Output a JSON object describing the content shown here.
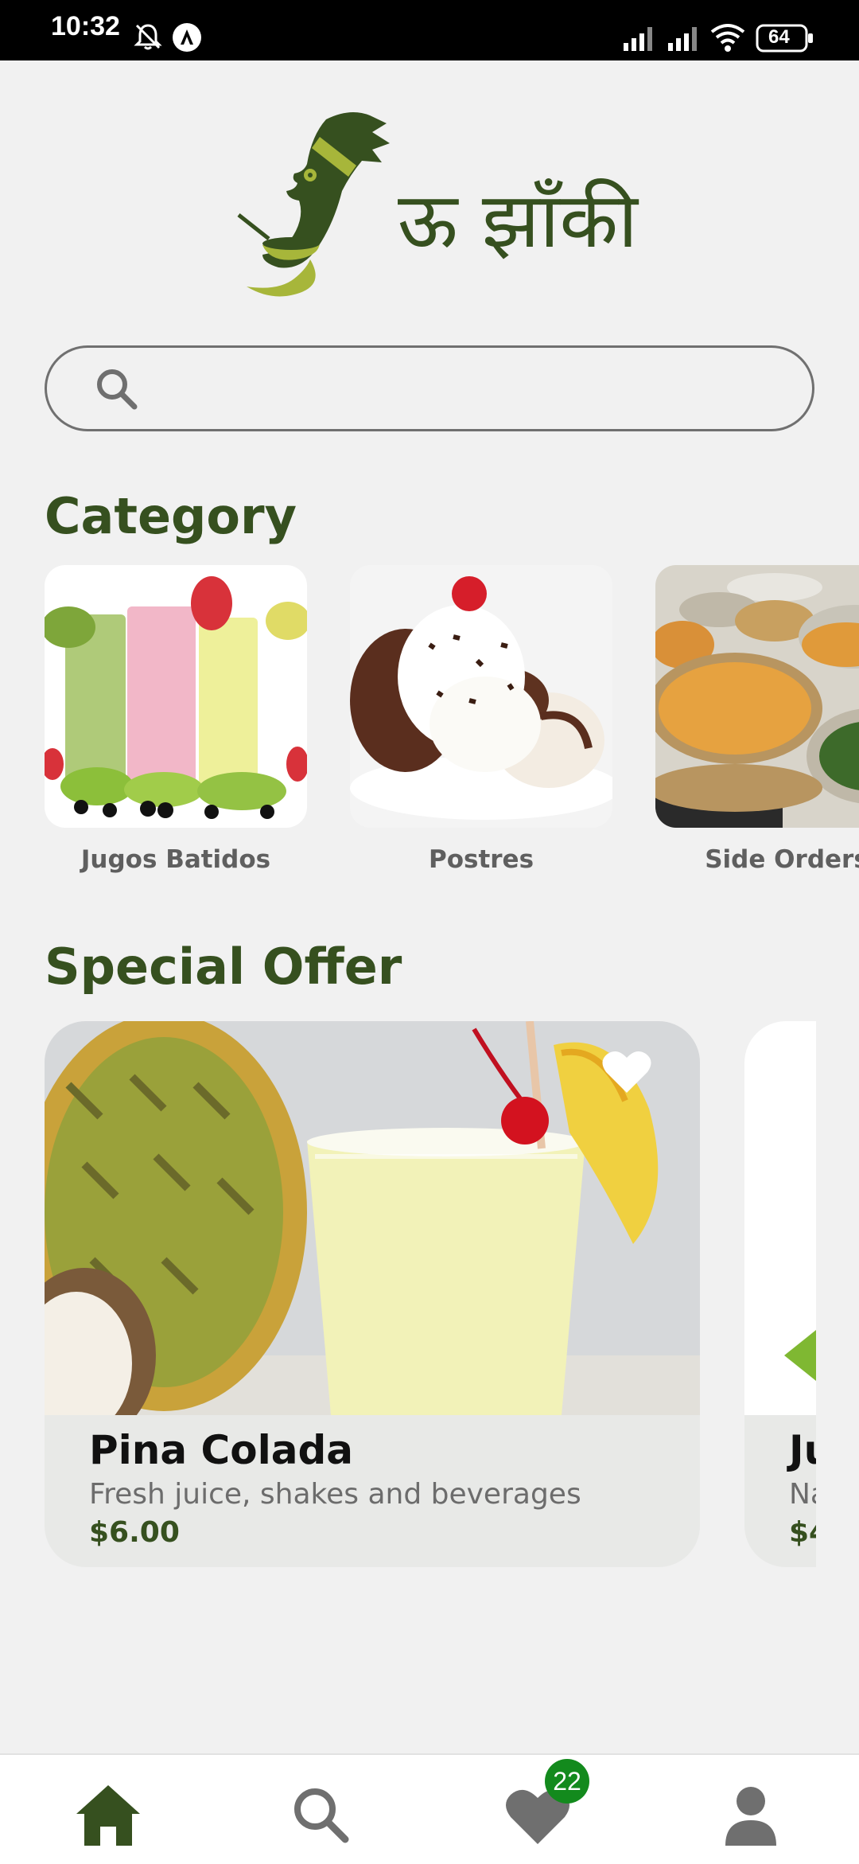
{
  "status_bar": {
    "time": "10:32",
    "battery": "64",
    "icons": [
      "bell-off-icon",
      "app-notification-icon",
      "signal-icon",
      "signal-icon",
      "wifi-icon",
      "battery-icon"
    ]
  },
  "brand": {
    "logo_text": "ऊ झाँकी",
    "logo_color": "#36501f",
    "accent_color": "#a7b63a"
  },
  "search": {
    "placeholder": "",
    "value": ""
  },
  "category": {
    "title": "Category",
    "items": [
      {
        "label": "Jugos Batidos",
        "image": "smoothie-glasses"
      },
      {
        "label": "Postres",
        "image": "ice-cream-dessert"
      },
      {
        "label": "Side Orders",
        "image": "fries-side-dishes"
      }
    ]
  },
  "special_offer": {
    "title": "Special Offer",
    "items": [
      {
        "name": "Pina Colada",
        "description": "Fresh juice, shakes and beverages",
        "price": "$6.00",
        "favorite": false
      },
      {
        "name": "Ju",
        "description": "Na",
        "price": "$4"
      }
    ]
  },
  "bottom_nav": {
    "items": [
      {
        "name": "home",
        "icon": "home-icon",
        "active": true
      },
      {
        "name": "search",
        "icon": "search-icon",
        "active": false
      },
      {
        "name": "favorites",
        "icon": "heart-icon",
        "active": false
      },
      {
        "name": "profile",
        "icon": "person-icon",
        "active": false
      }
    ],
    "favorites_badge": "22",
    "active_color": "#36501f",
    "inactive_color": "#6f6f6f",
    "badge_color": "#138a1d"
  }
}
